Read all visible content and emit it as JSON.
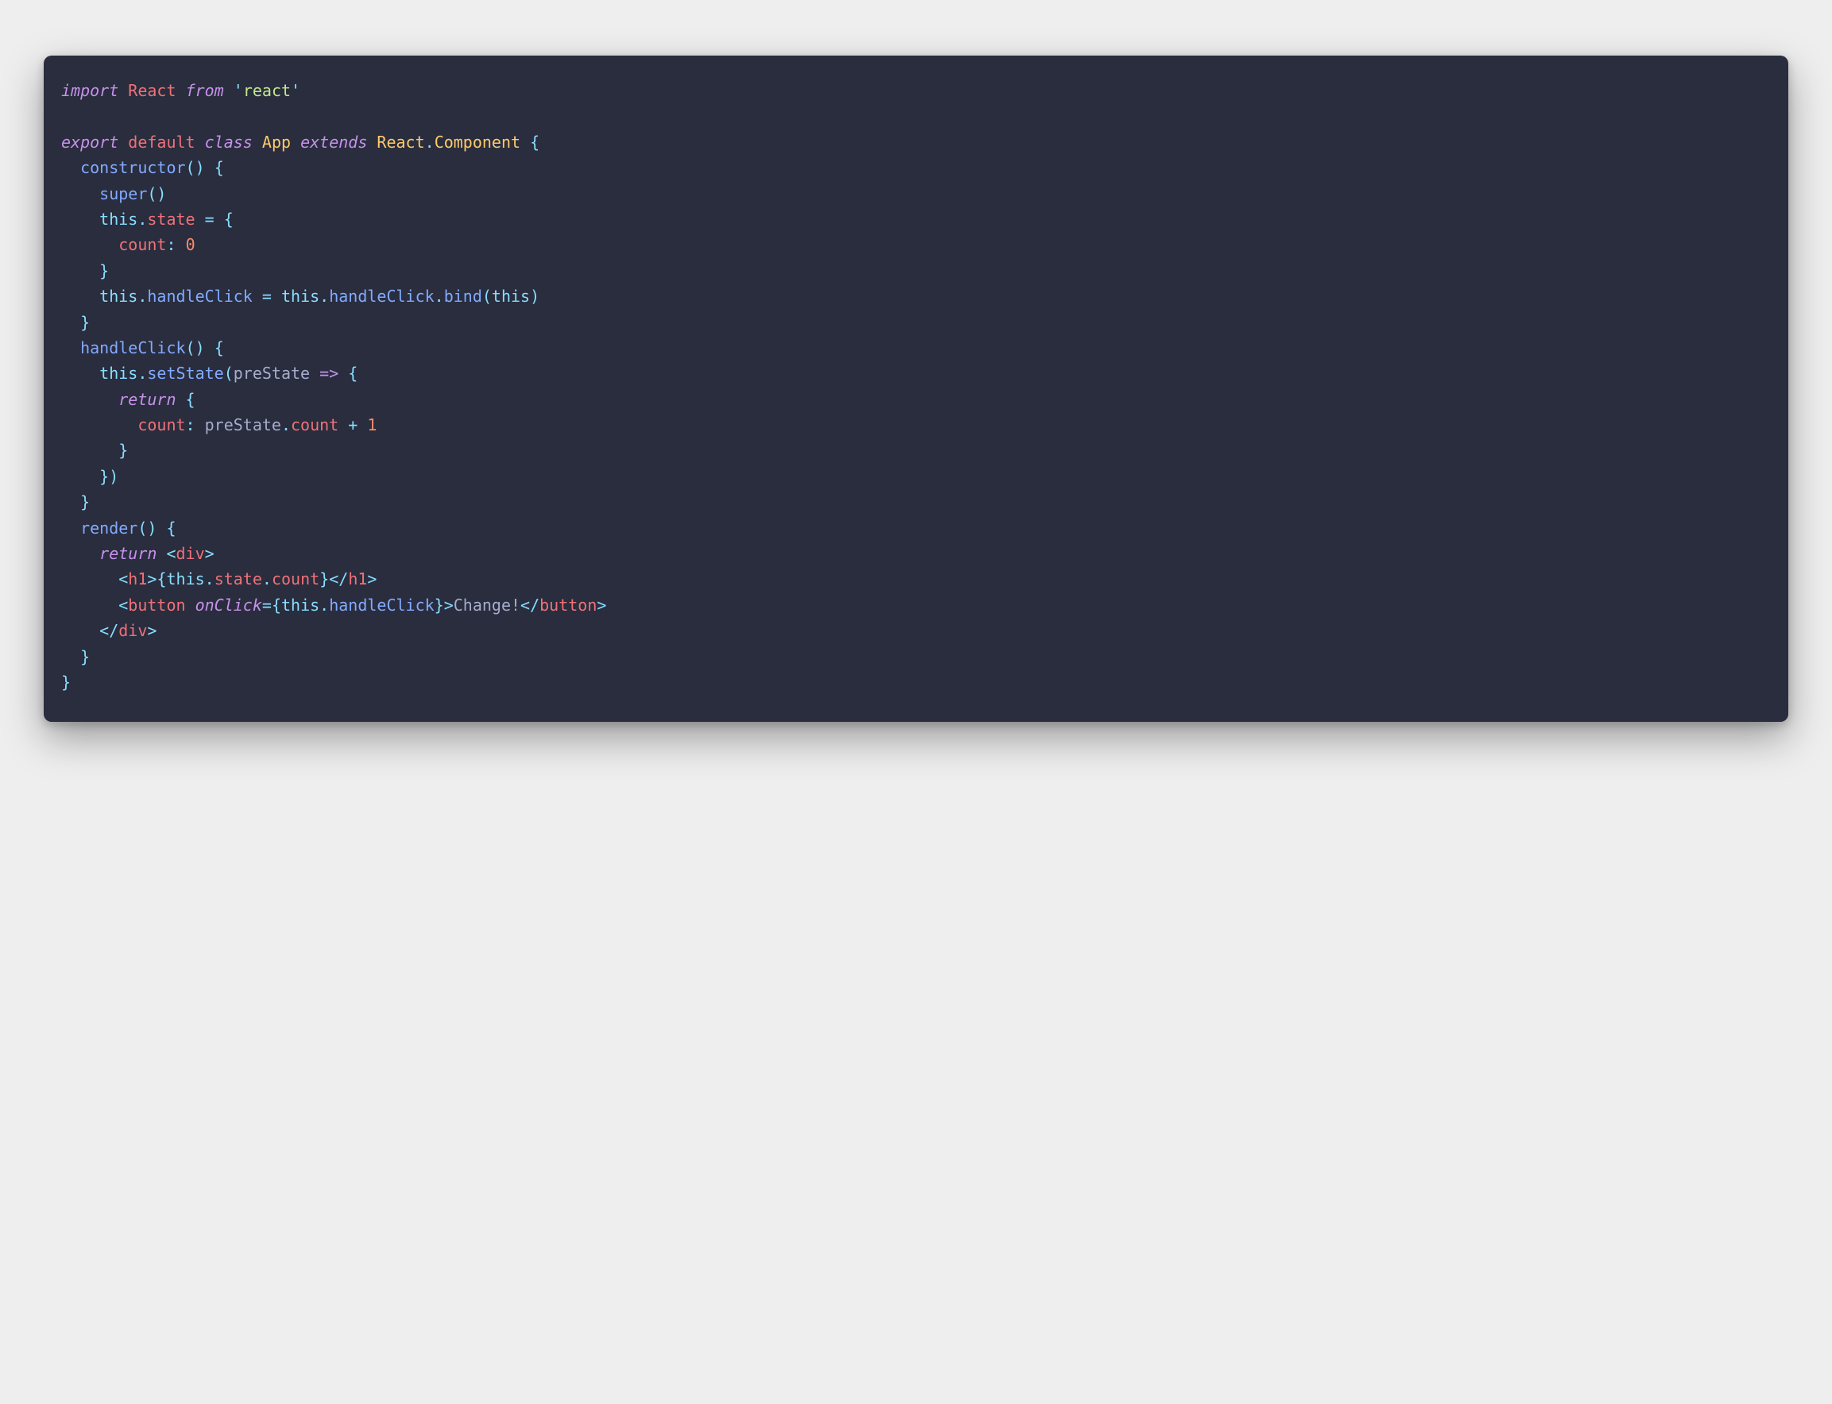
{
  "colors": {
    "background_page": "#eeeeee",
    "background_card": "#292d3e",
    "default_text": "#a6accd",
    "keyword": "#c792ea",
    "definition": "#f07178",
    "function": "#82aaff",
    "class": "#ffcb6b",
    "string": "#c3e88d",
    "number": "#f78c6c",
    "operator": "#89ddff"
  },
  "code": {
    "lines": [
      [
        {
          "t": "import",
          "c": "key"
        },
        {
          "t": " ",
          "c": "plain"
        },
        {
          "t": "React",
          "c": "def"
        },
        {
          "t": " ",
          "c": "plain"
        },
        {
          "t": "from",
          "c": "key"
        },
        {
          "t": " ",
          "c": "plain"
        },
        {
          "t": "'",
          "c": "op"
        },
        {
          "t": "react",
          "c": "str"
        },
        {
          "t": "'",
          "c": "op"
        }
      ],
      [],
      [
        {
          "t": "export",
          "c": "key"
        },
        {
          "t": " ",
          "c": "plain"
        },
        {
          "t": "default",
          "c": "def"
        },
        {
          "t": " ",
          "c": "plain"
        },
        {
          "t": "class",
          "c": "key"
        },
        {
          "t": " ",
          "c": "plain"
        },
        {
          "t": "App",
          "c": "cls"
        },
        {
          "t": " ",
          "c": "plain"
        },
        {
          "t": "extends",
          "c": "key"
        },
        {
          "t": " ",
          "c": "plain"
        },
        {
          "t": "React",
          "c": "cls"
        },
        {
          "t": ".",
          "c": "op"
        },
        {
          "t": "Component",
          "c": "cls"
        },
        {
          "t": " ",
          "c": "plain"
        },
        {
          "t": "{",
          "c": "op"
        }
      ],
      [
        {
          "t": "  ",
          "c": "plain"
        },
        {
          "t": "constructor",
          "c": "fn"
        },
        {
          "t": "()",
          "c": "op"
        },
        {
          "t": " ",
          "c": "plain"
        },
        {
          "t": "{",
          "c": "op"
        }
      ],
      [
        {
          "t": "    ",
          "c": "plain"
        },
        {
          "t": "super",
          "c": "fn"
        },
        {
          "t": "()",
          "c": "op"
        }
      ],
      [
        {
          "t": "    ",
          "c": "plain"
        },
        {
          "t": "this",
          "c": "op"
        },
        {
          "t": ".",
          "c": "op"
        },
        {
          "t": "state",
          "c": "def"
        },
        {
          "t": " ",
          "c": "plain"
        },
        {
          "t": "=",
          "c": "op"
        },
        {
          "t": " ",
          "c": "plain"
        },
        {
          "t": "{",
          "c": "op"
        }
      ],
      [
        {
          "t": "      ",
          "c": "plain"
        },
        {
          "t": "count",
          "c": "def"
        },
        {
          "t": ":",
          "c": "op"
        },
        {
          "t": " ",
          "c": "plain"
        },
        {
          "t": "0",
          "c": "num"
        }
      ],
      [
        {
          "t": "    ",
          "c": "plain"
        },
        {
          "t": "}",
          "c": "op"
        }
      ],
      [
        {
          "t": "    ",
          "c": "plain"
        },
        {
          "t": "this",
          "c": "op"
        },
        {
          "t": ".",
          "c": "op"
        },
        {
          "t": "handleClick",
          "c": "fn"
        },
        {
          "t": " ",
          "c": "plain"
        },
        {
          "t": "=",
          "c": "op"
        },
        {
          "t": " ",
          "c": "plain"
        },
        {
          "t": "this",
          "c": "op"
        },
        {
          "t": ".",
          "c": "op"
        },
        {
          "t": "handleClick",
          "c": "fn"
        },
        {
          "t": ".",
          "c": "op"
        },
        {
          "t": "bind",
          "c": "fn"
        },
        {
          "t": "(",
          "c": "op"
        },
        {
          "t": "this",
          "c": "op"
        },
        {
          "t": ")",
          "c": "op"
        }
      ],
      [
        {
          "t": "  ",
          "c": "plain"
        },
        {
          "t": "}",
          "c": "op"
        }
      ],
      [
        {
          "t": "  ",
          "c": "plain"
        },
        {
          "t": "handleClick",
          "c": "fn"
        },
        {
          "t": "()",
          "c": "op"
        },
        {
          "t": " ",
          "c": "plain"
        },
        {
          "t": "{",
          "c": "op"
        }
      ],
      [
        {
          "t": "    ",
          "c": "plain"
        },
        {
          "t": "this",
          "c": "op"
        },
        {
          "t": ".",
          "c": "op"
        },
        {
          "t": "setState",
          "c": "fn"
        },
        {
          "t": "(",
          "c": "op"
        },
        {
          "t": "preState",
          "c": "plain"
        },
        {
          "t": " ",
          "c": "plain"
        },
        {
          "t": "=>",
          "c": "key"
        },
        {
          "t": " ",
          "c": "plain"
        },
        {
          "t": "{",
          "c": "op"
        }
      ],
      [
        {
          "t": "      ",
          "c": "plain"
        },
        {
          "t": "return",
          "c": "key"
        },
        {
          "t": " ",
          "c": "plain"
        },
        {
          "t": "{",
          "c": "op"
        }
      ],
      [
        {
          "t": "        ",
          "c": "plain"
        },
        {
          "t": "count",
          "c": "def"
        },
        {
          "t": ":",
          "c": "op"
        },
        {
          "t": " ",
          "c": "plain"
        },
        {
          "t": "preState",
          "c": "plain"
        },
        {
          "t": ".",
          "c": "op"
        },
        {
          "t": "count",
          "c": "def"
        },
        {
          "t": " ",
          "c": "plain"
        },
        {
          "t": "+",
          "c": "op"
        },
        {
          "t": " ",
          "c": "plain"
        },
        {
          "t": "1",
          "c": "num"
        }
      ],
      [
        {
          "t": "      ",
          "c": "plain"
        },
        {
          "t": "}",
          "c": "op"
        }
      ],
      [
        {
          "t": "    ",
          "c": "plain"
        },
        {
          "t": "})",
          "c": "op"
        }
      ],
      [
        {
          "t": "  ",
          "c": "plain"
        },
        {
          "t": "}",
          "c": "op"
        }
      ],
      [
        {
          "t": "  ",
          "c": "plain"
        },
        {
          "t": "render",
          "c": "fn"
        },
        {
          "t": "()",
          "c": "op"
        },
        {
          "t": " ",
          "c": "plain"
        },
        {
          "t": "{",
          "c": "op"
        }
      ],
      [
        {
          "t": "    ",
          "c": "plain"
        },
        {
          "t": "return",
          "c": "key"
        },
        {
          "t": " ",
          "c": "plain"
        },
        {
          "t": "<",
          "c": "pun"
        },
        {
          "t": "div",
          "c": "tag"
        },
        {
          "t": ">",
          "c": "pun"
        }
      ],
      [
        {
          "t": "      ",
          "c": "plain"
        },
        {
          "t": "<",
          "c": "pun"
        },
        {
          "t": "h1",
          "c": "tag"
        },
        {
          "t": ">",
          "c": "pun"
        },
        {
          "t": "{",
          "c": "op"
        },
        {
          "t": "this",
          "c": "op"
        },
        {
          "t": ".",
          "c": "op"
        },
        {
          "t": "state",
          "c": "def"
        },
        {
          "t": ".",
          "c": "op"
        },
        {
          "t": "count",
          "c": "def"
        },
        {
          "t": "}",
          "c": "op"
        },
        {
          "t": "</",
          "c": "pun"
        },
        {
          "t": "h1",
          "c": "tag"
        },
        {
          "t": ">",
          "c": "pun"
        }
      ],
      [
        {
          "t": "      ",
          "c": "plain"
        },
        {
          "t": "<",
          "c": "pun"
        },
        {
          "t": "button",
          "c": "tag"
        },
        {
          "t": " ",
          "c": "plain"
        },
        {
          "t": "onClick",
          "c": "attr"
        },
        {
          "t": "=",
          "c": "op"
        },
        {
          "t": "{",
          "c": "op"
        },
        {
          "t": "this",
          "c": "op"
        },
        {
          "t": ".",
          "c": "op"
        },
        {
          "t": "handleClick",
          "c": "fn"
        },
        {
          "t": "}",
          "c": "op"
        },
        {
          "t": ">",
          "c": "pun"
        },
        {
          "t": "Change!",
          "c": "plain"
        },
        {
          "t": "</",
          "c": "pun"
        },
        {
          "t": "button",
          "c": "tag"
        },
        {
          "t": ">",
          "c": "pun"
        }
      ],
      [
        {
          "t": "    ",
          "c": "plain"
        },
        {
          "t": "</",
          "c": "pun"
        },
        {
          "t": "div",
          "c": "tag"
        },
        {
          "t": ">",
          "c": "pun"
        }
      ],
      [
        {
          "t": "  ",
          "c": "plain"
        },
        {
          "t": "}",
          "c": "op"
        }
      ],
      [
        {
          "t": "}",
          "c": "op"
        }
      ]
    ]
  }
}
